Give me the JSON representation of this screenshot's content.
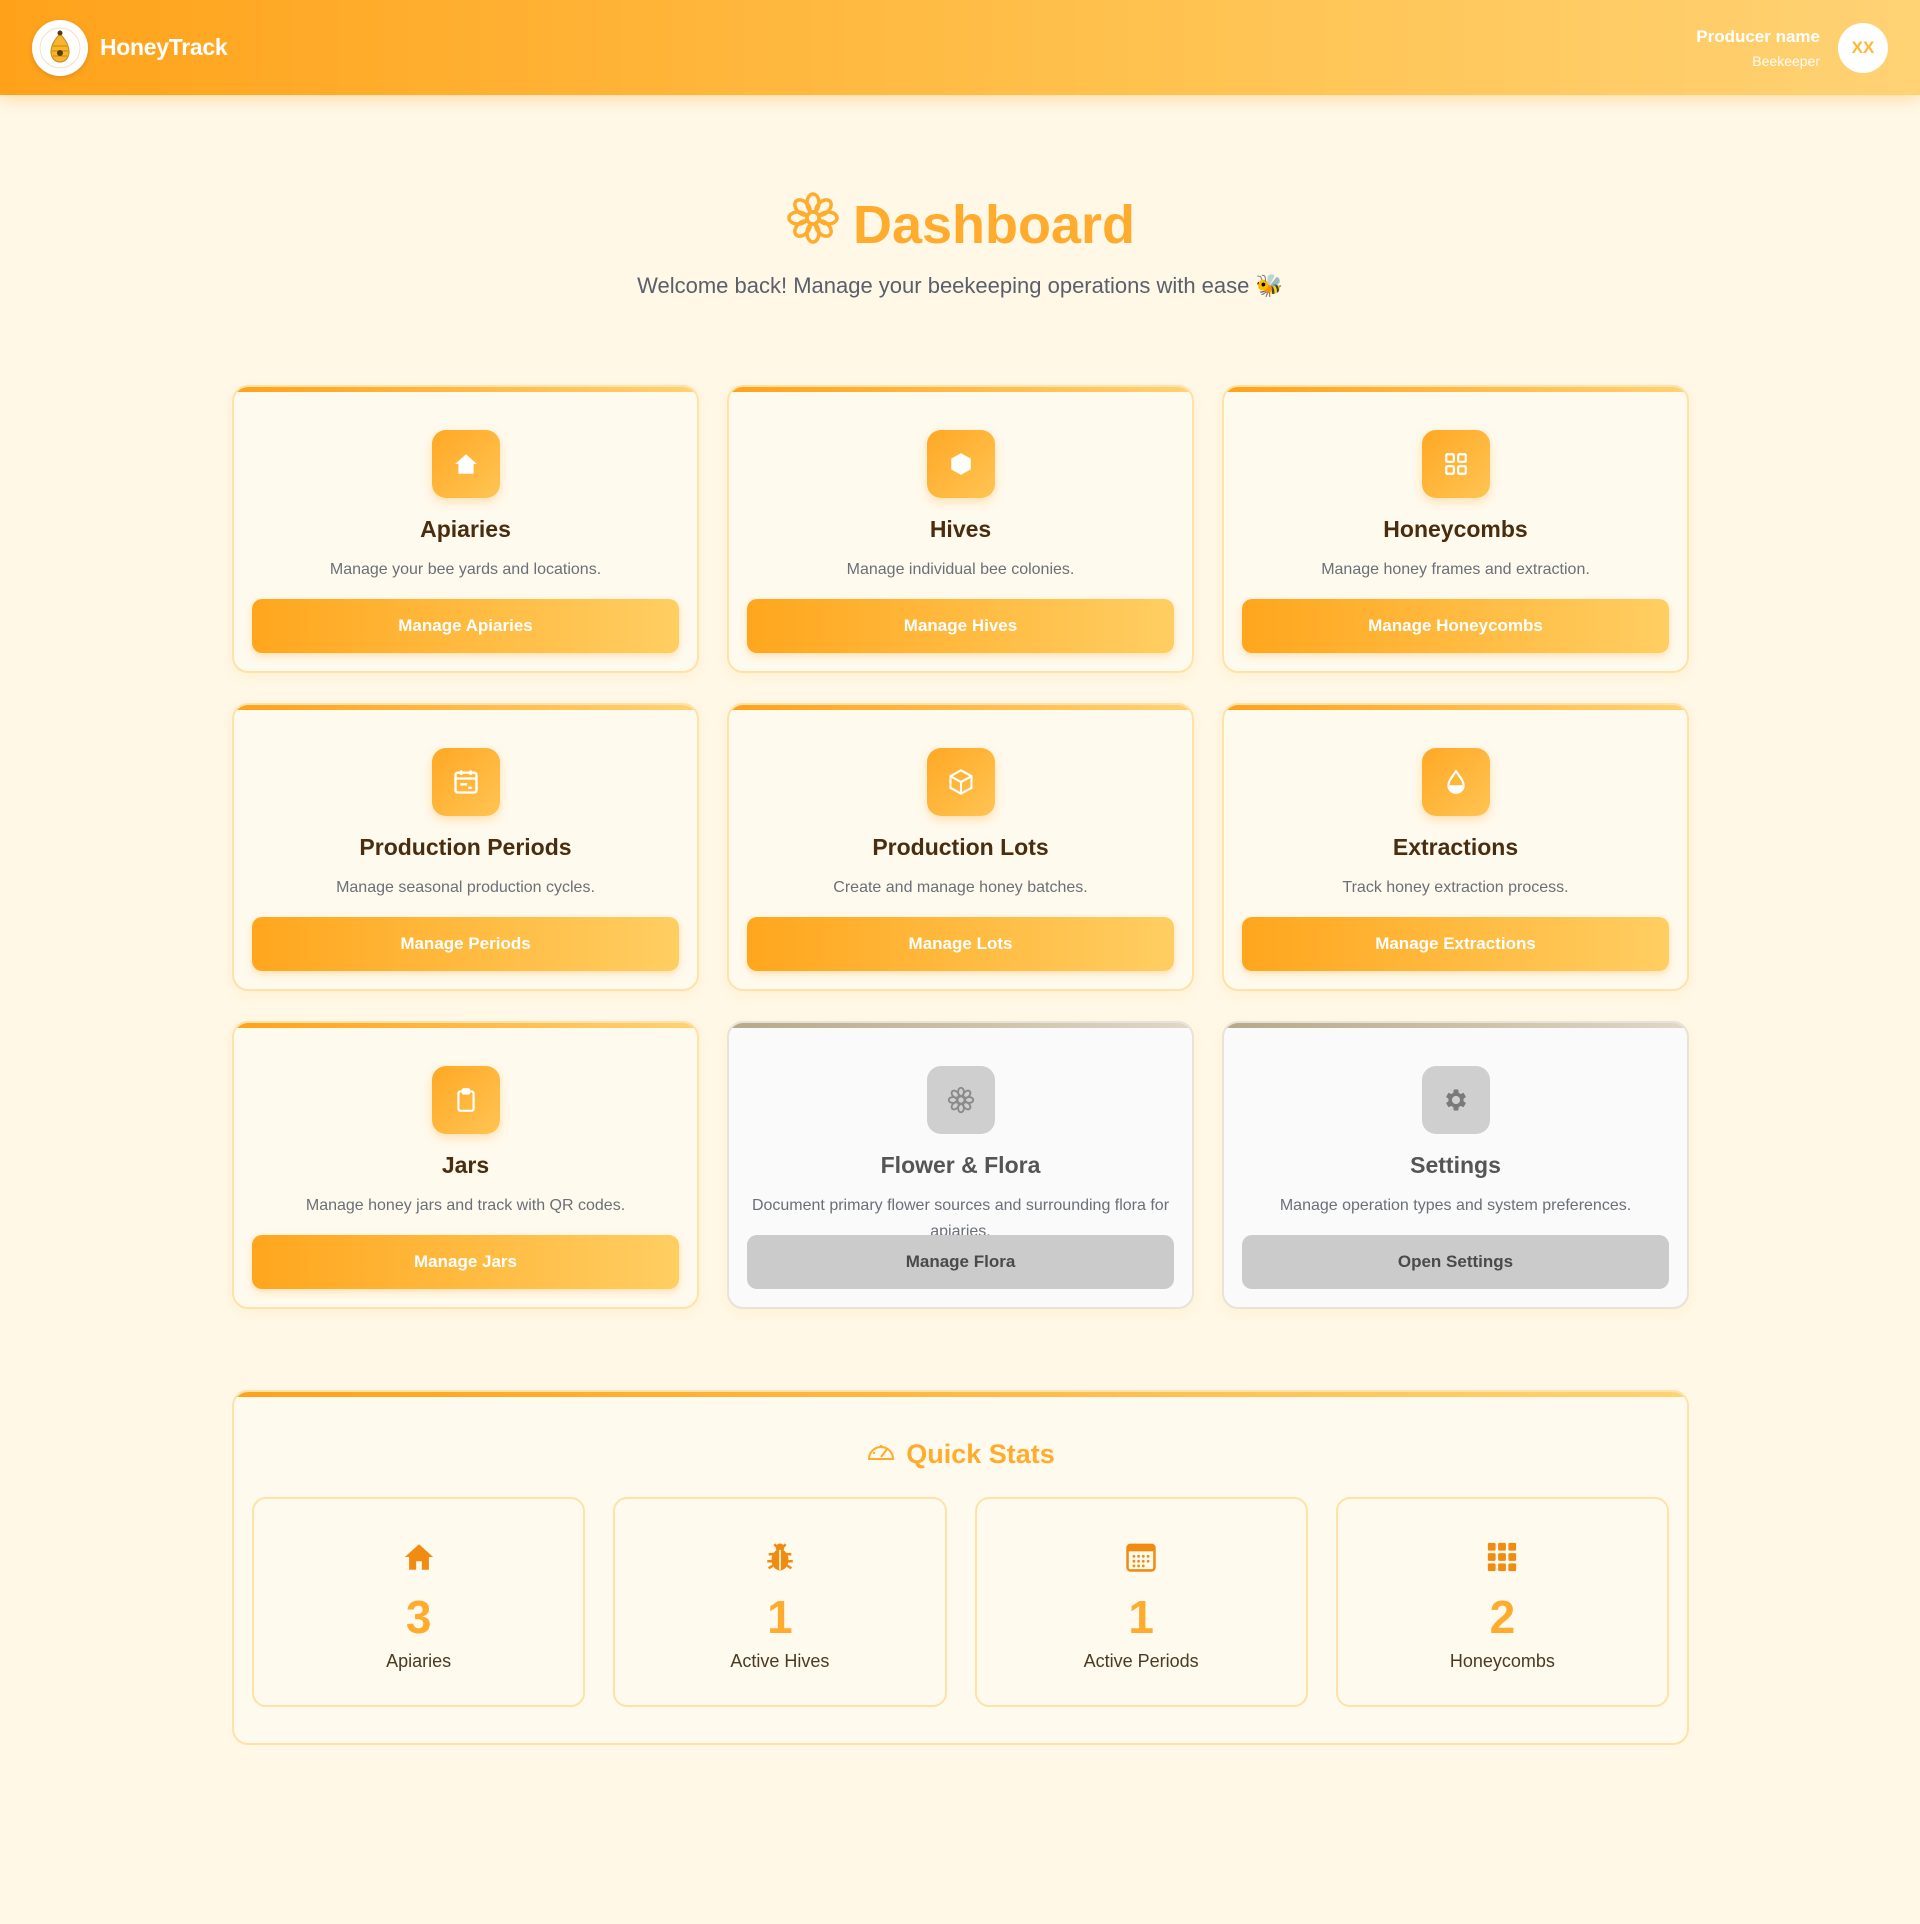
{
  "header": {
    "brand": "HoneyTrack",
    "user_name": "Producer name",
    "user_role": "Beekeeper",
    "avatar_initials": "XX"
  },
  "page": {
    "title": "Dashboard",
    "subtitle": "Welcome back! Manage your beekeeping operations with ease 🐝"
  },
  "cards": [
    {
      "title": "Apiaries",
      "desc": "Manage your bee yards and locations.",
      "button": "Manage Apiaries",
      "icon": "house-icon"
    },
    {
      "title": "Hives",
      "desc": "Manage individual bee colonies.",
      "button": "Manage Hives",
      "icon": "hexagon-icon"
    },
    {
      "title": "Honeycombs",
      "desc": "Manage honey frames and extraction.",
      "button": "Manage Honeycombs",
      "icon": "grid-icon"
    },
    {
      "title": "Production Periods",
      "desc": "Manage seasonal production cycles.",
      "button": "Manage Periods",
      "icon": "calendar-icon"
    },
    {
      "title": "Production Lots",
      "desc": "Create and manage honey batches.",
      "button": "Manage Lots",
      "icon": "box-icon"
    },
    {
      "title": "Extractions",
      "desc": "Track honey extraction process.",
      "button": "Manage Extractions",
      "icon": "droplet-icon"
    },
    {
      "title": "Jars",
      "desc": "Manage honey jars and track with QR codes.",
      "button": "Manage Jars",
      "icon": "clipboard-icon"
    },
    {
      "title": "Flower & Flora",
      "desc": "Document primary flower sources and surrounding flora for apiaries.",
      "button": "Manage Flora",
      "icon": "flower-icon"
    },
    {
      "title": "Settings",
      "desc": "Manage operation types and system preferences.",
      "button": "Open Settings",
      "icon": "gear-icon"
    }
  ],
  "stats": {
    "title": "Quick Stats",
    "items": [
      {
        "value": "3",
        "label": "Apiaries",
        "icon": "house-icon"
      },
      {
        "value": "1",
        "label": "Active Hives",
        "icon": "bug-icon"
      },
      {
        "value": "1",
        "label": "Active Periods",
        "icon": "calendar-icon"
      },
      {
        "value": "2",
        "label": "Honeycombs",
        "icon": "grid-icon"
      }
    ]
  },
  "colors": {
    "accent": "#ffac2e",
    "header_start": "#ffa21a",
    "header_end": "#ffd274",
    "background": "#fff8e6",
    "disabled": "#cbcbcb"
  }
}
